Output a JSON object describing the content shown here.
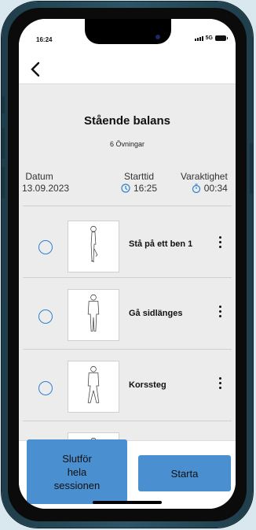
{
  "status": {
    "time": "16:24",
    "network": "5G"
  },
  "nav": {
    "back_icon": "chevron-left-icon"
  },
  "session": {
    "title": "Stående balans",
    "subtitle": "6 Övningar"
  },
  "meta": {
    "date_label": "Datum",
    "date_value": "13.09.2023",
    "start_label": "Starttid",
    "start_value": "16:25",
    "duration_label": "Varaktighet",
    "duration_value": "00:34"
  },
  "exercises": [
    {
      "label": "Stå på ett ben 1",
      "pose": "side-one-leg"
    },
    {
      "label": "Gå sidlänges",
      "pose": "front-standing"
    },
    {
      "label": "Korssteg",
      "pose": "front-step"
    },
    {
      "label": "",
      "pose": "front-standing"
    }
  ],
  "footer": {
    "finish_label": "Slutför hela sessionen",
    "finish_lines": [
      "Slutför",
      "hela",
      "sessionen"
    ],
    "start_label": "Starta"
  },
  "colors": {
    "accent": "#4a8fd0",
    "icon_blue": "#2f80d0"
  }
}
